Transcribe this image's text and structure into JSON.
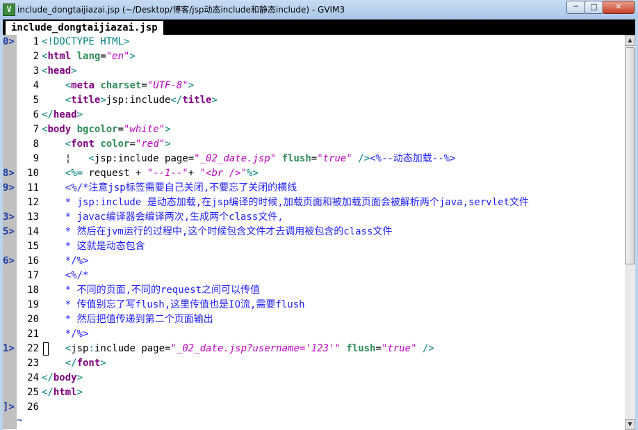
{
  "window": {
    "icon": "gvim-icon",
    "title": "include_dongtaijiazai.jsp (~/Desktop/博客/jsp动态include和静态include) - GVIM3",
    "min_label": "─",
    "max_label": "□",
    "close_label": "✕"
  },
  "tab": {
    "label": "include_dongtaijiazai.jsp"
  },
  "lines": [
    {
      "sign": "0>",
      "num": "1",
      "segs": [
        [
          "tagc",
          "<!DOCTYPE HTML>"
        ]
      ]
    },
    {
      "sign": "",
      "num": "2",
      "segs": [
        [
          "tagc",
          "<"
        ],
        [
          "tagn",
          "html"
        ],
        [
          "txt",
          " "
        ],
        [
          "attr",
          "lang"
        ],
        [
          "txt",
          "="
        ],
        [
          "str",
          "\"en\""
        ],
        [
          "tagc",
          ">"
        ]
      ]
    },
    {
      "sign": "",
      "num": "3",
      "segs": [
        [
          "tagc",
          "<"
        ],
        [
          "tagn",
          "head"
        ],
        [
          "tagc",
          ">"
        ]
      ]
    },
    {
      "sign": "",
      "num": "4",
      "segs": [
        [
          "txt",
          "    "
        ],
        [
          "tagc",
          "<"
        ],
        [
          "tagn",
          "meta"
        ],
        [
          "txt",
          " "
        ],
        [
          "attr",
          "charset"
        ],
        [
          "txt",
          "="
        ],
        [
          "str",
          "\"UTF-8\""
        ],
        [
          "tagc",
          ">"
        ]
      ]
    },
    {
      "sign": "",
      "num": "5",
      "segs": [
        [
          "txt",
          "    "
        ],
        [
          "tagc",
          "<"
        ],
        [
          "tagn",
          "title"
        ],
        [
          "tagc",
          ">"
        ],
        [
          "txt",
          "jsp:include"
        ],
        [
          "tagc",
          "</"
        ],
        [
          "tagn",
          "title"
        ],
        [
          "tagc",
          ">"
        ]
      ]
    },
    {
      "sign": "",
      "num": "6",
      "segs": [
        [
          "tagc",
          "</"
        ],
        [
          "tagn",
          "head"
        ],
        [
          "tagc",
          ">"
        ]
      ]
    },
    {
      "sign": "",
      "num": "7",
      "segs": [
        [
          "tagc",
          "<"
        ],
        [
          "tagn",
          "body"
        ],
        [
          "txt",
          " "
        ],
        [
          "attr",
          "bgcolor"
        ],
        [
          "txt",
          "="
        ],
        [
          "str",
          "\"white\""
        ],
        [
          "tagc",
          ">"
        ]
      ]
    },
    {
      "sign": "",
      "num": "8",
      "segs": [
        [
          "txt",
          "    "
        ],
        [
          "tagc",
          "<"
        ],
        [
          "tagn",
          "font"
        ],
        [
          "txt",
          " "
        ],
        [
          "attr",
          "color"
        ],
        [
          "txt",
          "="
        ],
        [
          "str",
          "\"red\""
        ],
        [
          "tagc",
          ">"
        ]
      ]
    },
    {
      "sign": "",
      "num": "9",
      "segs": [
        [
          "txt",
          "    ¦   "
        ],
        [
          "tagc",
          "<"
        ],
        [
          "txt",
          "jsp:include page="
        ],
        [
          "str",
          "\"_02_date.jsp\""
        ],
        [
          "txt",
          " "
        ],
        [
          "attr",
          "flush"
        ],
        [
          "txt",
          "="
        ],
        [
          "str",
          "\"true\""
        ],
        [
          "txt",
          " "
        ],
        [
          "tagc",
          "/>"
        ],
        [
          "cmt",
          "<%--动态加载--%>"
        ]
      ]
    },
    {
      "sign": "8>",
      "num": "10",
      "segs": [
        [
          "txt",
          "    "
        ],
        [
          "tagc",
          "<%="
        ],
        [
          "txt",
          " request + "
        ],
        [
          "str",
          "\"--1--\""
        ],
        [
          "txt",
          "+ "
        ],
        [
          "str",
          "\"<br />\""
        ],
        [
          "tagc",
          "%>"
        ]
      ]
    },
    {
      "sign": "9>",
      "num": "11",
      "segs": [
        [
          "txt",
          "    "
        ],
        [
          "cmt",
          "<%/*注意jsp标签需要自己关闭,不要忘了关闭的横线"
        ]
      ]
    },
    {
      "sign": "",
      "num": "12",
      "segs": [
        [
          "txt",
          "    "
        ],
        [
          "cmt",
          "* jsp:include 是动态加载,在jsp编译的时候,加载页面和被加载页面会被解析两个java,servlet文件"
        ]
      ]
    },
    {
      "sign": "3>",
      "num": "13",
      "segs": [
        [
          "txt",
          "    "
        ],
        [
          "cmt",
          "* javac编译器会编译两次,生成两个class文件,"
        ]
      ]
    },
    {
      "sign": "5>",
      "num": "14",
      "segs": [
        [
          "txt",
          "    "
        ],
        [
          "cmt",
          "* 然后在jvm运行的过程中,这个时候包含文件才去调用被包含的class文件"
        ]
      ]
    },
    {
      "sign": "",
      "num": "15",
      "segs": [
        [
          "txt",
          "    "
        ],
        [
          "cmt",
          "* 这就是动态包含"
        ]
      ]
    },
    {
      "sign": "6>",
      "num": "16",
      "segs": [
        [
          "txt",
          "    "
        ],
        [
          "cmt",
          "*/%>"
        ]
      ]
    },
    {
      "sign": "",
      "num": "17",
      "segs": [
        [
          "txt",
          "    "
        ],
        [
          "cmt",
          "<%/*"
        ]
      ]
    },
    {
      "sign": "",
      "num": "18",
      "segs": [
        [
          "txt",
          "    "
        ],
        [
          "cmt",
          "* 不同的页面,不同的request之间可以传值"
        ]
      ]
    },
    {
      "sign": "",
      "num": "19",
      "segs": [
        [
          "txt",
          "    "
        ],
        [
          "cmt",
          "* 传值别忘了写flush,这里传值也是IO流,需要flush"
        ]
      ]
    },
    {
      "sign": "",
      "num": "20",
      "segs": [
        [
          "txt",
          "    "
        ],
        [
          "cmt",
          "* 然后把值传递到第二个页面输出"
        ]
      ]
    },
    {
      "sign": "",
      "num": "21",
      "segs": [
        [
          "txt",
          "    "
        ],
        [
          "cmt",
          "*/%>"
        ]
      ]
    },
    {
      "sign": "1>",
      "num": "22",
      "segs": [
        [
          "txt",
          "    "
        ],
        [
          "tagc",
          "<"
        ],
        [
          "txt",
          "jsp"
        ],
        [
          "tagc",
          ":"
        ],
        [
          "txt",
          "include page="
        ],
        [
          "str",
          "\"_02_date.jsp?username='123'\""
        ],
        [
          "txt",
          " "
        ],
        [
          "attr",
          "flush"
        ],
        [
          "txt",
          "="
        ],
        [
          "str",
          "\"true\""
        ],
        [
          "txt",
          " "
        ],
        [
          "tagc",
          "/>"
        ]
      ]
    },
    {
      "sign": "",
      "num": "23",
      "segs": [
        [
          "txt",
          "    "
        ],
        [
          "tagc",
          "</"
        ],
        [
          "tagn",
          "font"
        ],
        [
          "tagc",
          ">"
        ]
      ]
    },
    {
      "sign": "",
      "num": "24",
      "segs": [
        [
          "tagc",
          "</"
        ],
        [
          "tagn",
          "body"
        ],
        [
          "tagc",
          ">"
        ]
      ]
    },
    {
      "sign": "",
      "num": "25",
      "segs": [
        [
          "tagc",
          "</"
        ],
        [
          "tagn",
          "html"
        ],
        [
          "tagc",
          ">"
        ]
      ]
    },
    {
      "sign": "]>",
      "num": "26",
      "segs": []
    }
  ],
  "empty_marker": "~",
  "colors": {
    "tag_bracket": "#008080",
    "tag_name": "#800080",
    "attribute": "#2e8b57",
    "string": "#c000c0",
    "comment": "#2020ff",
    "sign_column": "#c0c0c0"
  }
}
